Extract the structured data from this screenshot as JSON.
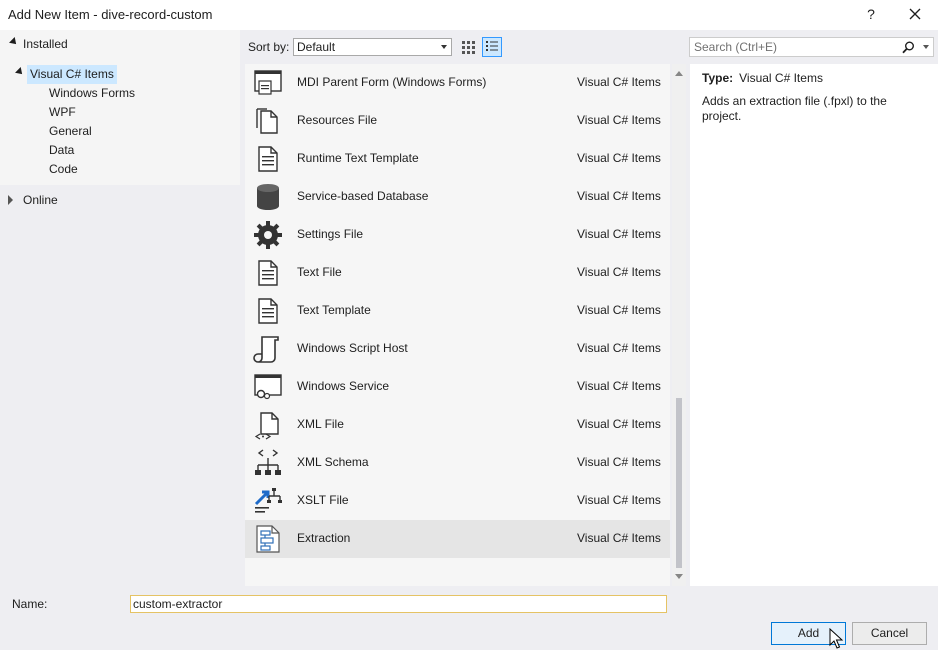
{
  "window": {
    "title": "Add New Item - dive-record-custom",
    "help_label": "?"
  },
  "tree": {
    "installed_label": "Installed",
    "root_label": "Visual C# Items",
    "children": [
      "Windows Forms",
      "WPF",
      "General",
      "Data",
      "Code"
    ],
    "online_label": "Online"
  },
  "toolbar": {
    "sort_label": "Sort by:",
    "sort_value": "Default"
  },
  "search": {
    "placeholder": "Search (Ctrl+E)"
  },
  "items": [
    {
      "name": "MDI Parent Form (Windows Forms)",
      "category": "Visual C# Items",
      "icon": "mdi-form-icon"
    },
    {
      "name": "Resources File",
      "category": "Visual C# Items",
      "icon": "resources-file-icon"
    },
    {
      "name": "Runtime Text Template",
      "category": "Visual C# Items",
      "icon": "runtime-text-template-icon"
    },
    {
      "name": "Service-based Database",
      "category": "Visual C# Items",
      "icon": "database-icon"
    },
    {
      "name": "Settings File",
      "category": "Visual C# Items",
      "icon": "gear-icon"
    },
    {
      "name": "Text File",
      "category": "Visual C# Items",
      "icon": "text-file-icon"
    },
    {
      "name": "Text Template",
      "category": "Visual C# Items",
      "icon": "text-template-icon"
    },
    {
      "name": "Windows Script Host",
      "category": "Visual C# Items",
      "icon": "script-icon"
    },
    {
      "name": "Windows Service",
      "category": "Visual C# Items",
      "icon": "windows-service-icon"
    },
    {
      "name": "XML File",
      "category": "Visual C# Items",
      "icon": "xml-file-icon"
    },
    {
      "name": "XML Schema",
      "category": "Visual C# Items",
      "icon": "xml-schema-icon"
    },
    {
      "name": "XSLT File",
      "category": "Visual C# Items",
      "icon": "xslt-file-icon"
    },
    {
      "name": "Extraction",
      "category": "Visual C# Items",
      "icon": "extraction-icon",
      "selected": true
    }
  ],
  "details": {
    "type_label": "Type:",
    "type_value": "Visual C# Items",
    "description": "Adds an extraction file (.fpxl) to the project."
  },
  "footer": {
    "name_label": "Name:",
    "name_value": "custom-extractor",
    "add_label": "Add",
    "cancel_label": "Cancel"
  },
  "colors": {
    "selection": "#cce8ff",
    "accent": "#0078d7",
    "input_border": "#e5c365"
  }
}
